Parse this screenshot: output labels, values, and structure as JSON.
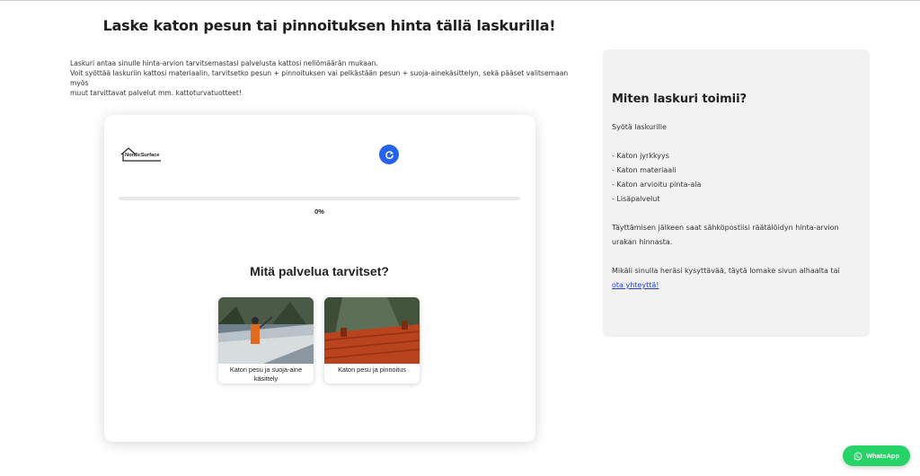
{
  "page": {
    "title": "Laske katon pesun tai pinnoituksen hinta tällä laskurilla!",
    "intro_lines": [
      "Laskuri antaa sinulle hinta-arvion tarvitsemastasi palvelusta kattosi neliömäärän mukaan.",
      "Voit syöttää laskuriin kattosi materiaalin, tarvitsetko pesun + pinnoituksen vai pelkästään pesun + suoja-ainekäsittelyn, sekä pääset valitsemaan myös",
      "muut tarvittavat palvelut mm. kattoturvatuotteet!"
    ]
  },
  "calculator": {
    "logo_text": "NordicSurface",
    "reset_icon": "refresh-icon",
    "progress": {
      "percent": 0,
      "label": "0%"
    },
    "question": "Mitä palvelua tarvitset?",
    "options": [
      {
        "label_line1": "Katon pesu ja suoja-aine",
        "label_line2": "käsittely"
      },
      {
        "label_line1": "Katon pesu ja pinnoitus",
        "label_line2": ""
      }
    ],
    "accent_color": "#2563eb"
  },
  "info": {
    "title": "Miten laskuri toimii?",
    "intro": "Syötä laskurille",
    "list": [
      "- Katon jyrkkyys",
      "- Katon materiaali",
      "- Katon arvioitu pinta-ala",
      "- Lisäpalvelut"
    ],
    "paragraph_lines": [
      "Täyttämisen jälkeen saat sähköpostiisi räätälöidyn hinta-arvion",
      "urakan hinnasta."
    ],
    "contact_line": "Mikäli sinulla heräsi kysyttävää, täytä lomake sivun alhaalta tai",
    "contact_link": "ota yhteyttä!"
  },
  "whatsapp": {
    "label": "WhatsApp",
    "color": "#25d366"
  }
}
